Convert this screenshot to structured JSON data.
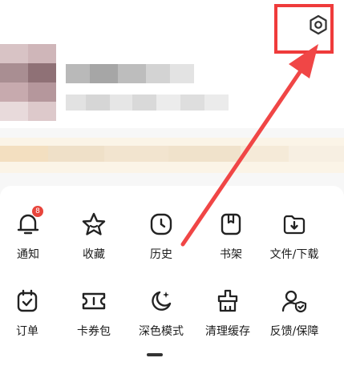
{
  "header": {
    "settings_icon": "gear-icon",
    "highlight_color": "#ef3b3b"
  },
  "menu": {
    "row1": [
      {
        "label": "通知",
        "icon": "bell-icon",
        "badge": "8"
      },
      {
        "label": "收藏",
        "icon": "star-icon"
      },
      {
        "label": "历史",
        "icon": "clock-icon"
      },
      {
        "label": "书架",
        "icon": "bookshelf-icon"
      },
      {
        "label": "文件/下载",
        "icon": "download-folder-icon"
      }
    ],
    "row2": [
      {
        "label": "订单",
        "icon": "order-icon"
      },
      {
        "label": "卡券包",
        "icon": "coupon-icon"
      },
      {
        "label": "深色模式",
        "icon": "moon-icon"
      },
      {
        "label": "清理缓存",
        "icon": "clean-icon"
      },
      {
        "label": "反馈/保障",
        "icon": "user-shield-icon"
      }
    ]
  }
}
